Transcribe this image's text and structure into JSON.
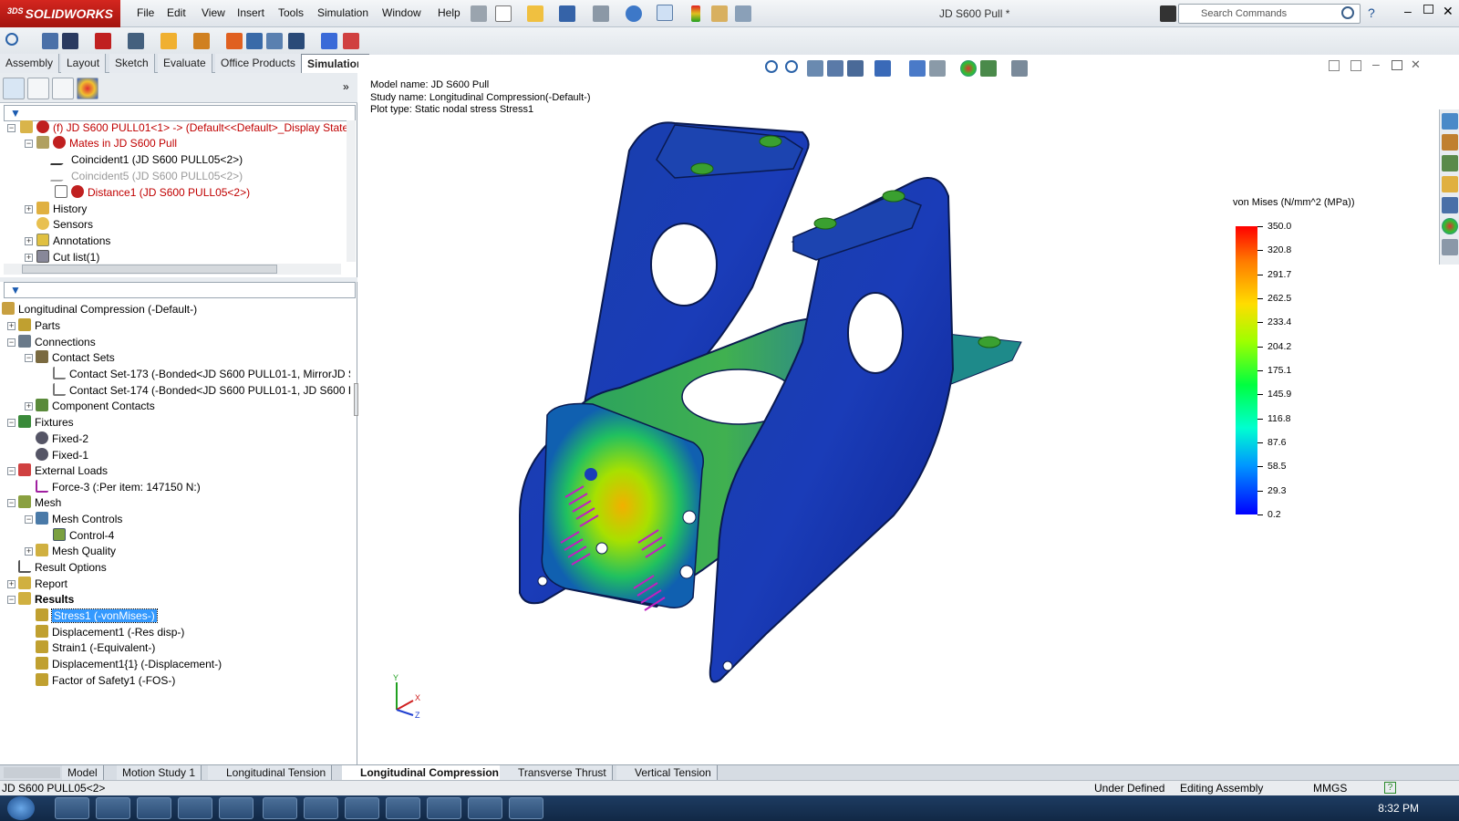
{
  "app": {
    "brand": "SOLIDWORKS",
    "brand_prefix": "3DS",
    "doc_title": "JD S600 Pull *"
  },
  "menu": [
    "File",
    "Edit",
    "View",
    "Insert",
    "Tools",
    "Simulation",
    "Window",
    "Help"
  ],
  "search": {
    "placeholder": "Search Commands"
  },
  "cmd_tabs": [
    "Assembly",
    "Layout",
    "Sketch",
    "Evaluate",
    "Office Products",
    "Simulation"
  ],
  "feature_tree": [
    {
      "text": "(f) JD S600 PULL01<1> -> (Default<<Default>_Display State",
      "style": "red"
    },
    {
      "text": "Mates in JD S600 Pull",
      "style": "red"
    },
    {
      "text": "Coincident1 (JD S600 PULL05<2>)",
      "style": ""
    },
    {
      "text": "Coincident5 (JD S600 PULL05<2>)",
      "style": "gray"
    },
    {
      "text": "Distance1 (JD S600 PULL05<2>)",
      "style": "red"
    },
    {
      "text": "History",
      "style": ""
    },
    {
      "text": "Sensors",
      "style": ""
    },
    {
      "text": "Annotations",
      "style": ""
    },
    {
      "text": "Cut list(1)",
      "style": ""
    }
  ],
  "sim_tree": [
    {
      "text": "Longitudinal Compression (-Default-)"
    },
    {
      "text": "Parts"
    },
    {
      "text": "Connections"
    },
    {
      "text": "Contact Sets"
    },
    {
      "text": "Contact Set-173 (-Bonded<JD S600 PULL01-1, MirrorJD S600"
    },
    {
      "text": "Contact Set-174 (-Bonded<JD S600 PULL01-1, JD S600 PULL"
    },
    {
      "text": "Component Contacts"
    },
    {
      "text": "Fixtures"
    },
    {
      "text": "Fixed-2"
    },
    {
      "text": "Fixed-1"
    },
    {
      "text": "External Loads"
    },
    {
      "text": "Force-3 (:Per item: 147150 N:)"
    },
    {
      "text": "Mesh"
    },
    {
      "text": "Mesh Controls"
    },
    {
      "text": "Control-4"
    },
    {
      "text": "Mesh Quality"
    },
    {
      "text": "Result Options"
    },
    {
      "text": "Report"
    },
    {
      "text": "Results"
    },
    {
      "text": "Stress1 (-vonMises-)"
    },
    {
      "text": "Displacement1 (-Res disp-)"
    },
    {
      "text": "Strain1 (-Equivalent-)"
    },
    {
      "text": "Displacement1{1} (-Displacement-)"
    },
    {
      "text": "Factor of Safety1 (-FOS-)"
    }
  ],
  "model_info": {
    "model_name": "Model name: JD S600 Pull",
    "study_name": "Study name: Longitudinal Compression(-Default-)",
    "plot_type": "Plot type: Static nodal stress Stress1"
  },
  "legend": {
    "title": "von Mises (N/mm^2 (MPa))",
    "values": [
      "350.0",
      "320.8",
      "291.7",
      "262.5",
      "233.4",
      "204.2",
      "175.1",
      "145.9",
      "116.8",
      "87.6",
      "58.5",
      "29.3",
      "0.2"
    ]
  },
  "triad": {
    "x": "X",
    "y": "Y",
    "z": "Z"
  },
  "bottom_tabs": [
    "Model",
    "Motion Study 1",
    "Longitudinal Tension",
    "Longitudinal Compression",
    "Transverse Thrust",
    "Vertical Tension"
  ],
  "status": {
    "left": "JD S600 PULL05<2>",
    "state": "Under Defined",
    "mode": "Editing Assembly",
    "units": "MMGS"
  },
  "clock": "8:32 PM",
  "colors": {
    "accent_red": "#c00000",
    "selection": "#3399ff",
    "brand": "#d4261f"
  }
}
